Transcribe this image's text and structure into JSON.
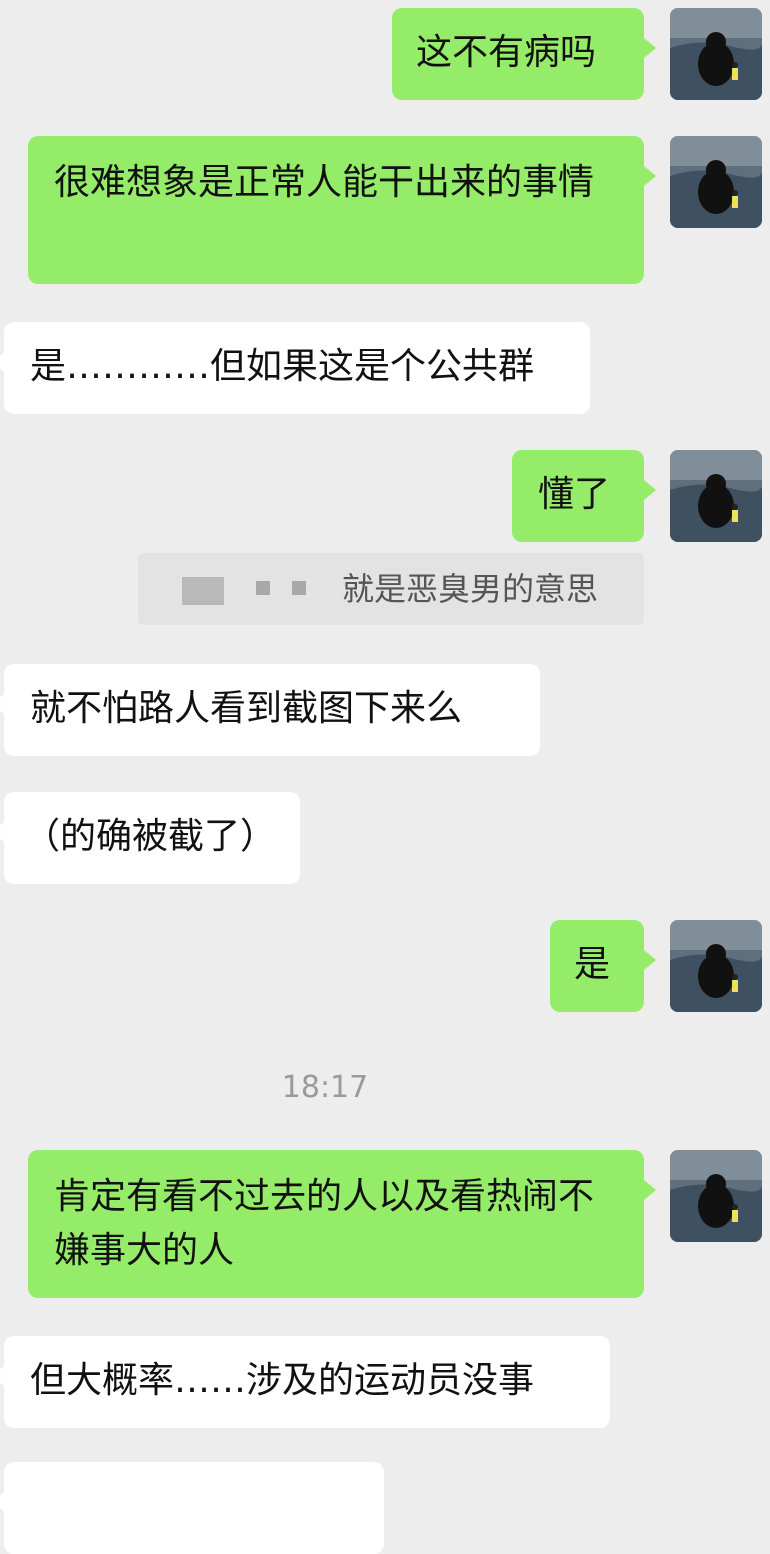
{
  "chat": {
    "messages": [
      {
        "side": "right",
        "text": "这不有病吗"
      },
      {
        "side": "right",
        "text": "很难想象是正常人能干出来的事情"
      },
      {
        "side": "left",
        "text": "是…………但如果这是个公共群"
      },
      {
        "side": "right",
        "text": "懂了"
      },
      {
        "side": "left",
        "text": "就不怕路人看到截图下来么"
      },
      {
        "side": "left",
        "text": "（的确被截了）"
      },
      {
        "side": "right",
        "text": "是"
      },
      {
        "side": "right",
        "text": "肯定有看不过去的人以及看热闹不嫌事大的人"
      },
      {
        "side": "left",
        "text": "但大概率……涉及的运动员没事"
      }
    ],
    "quote": {
      "text": "就是恶臭男的意思"
    },
    "timestamp": "18:17"
  },
  "colors": {
    "background": "#ededed",
    "sent_bubble": "#95ec69",
    "received_bubble": "#ffffff"
  },
  "icons": {
    "avatar": "bear-silhouette-avatar"
  }
}
